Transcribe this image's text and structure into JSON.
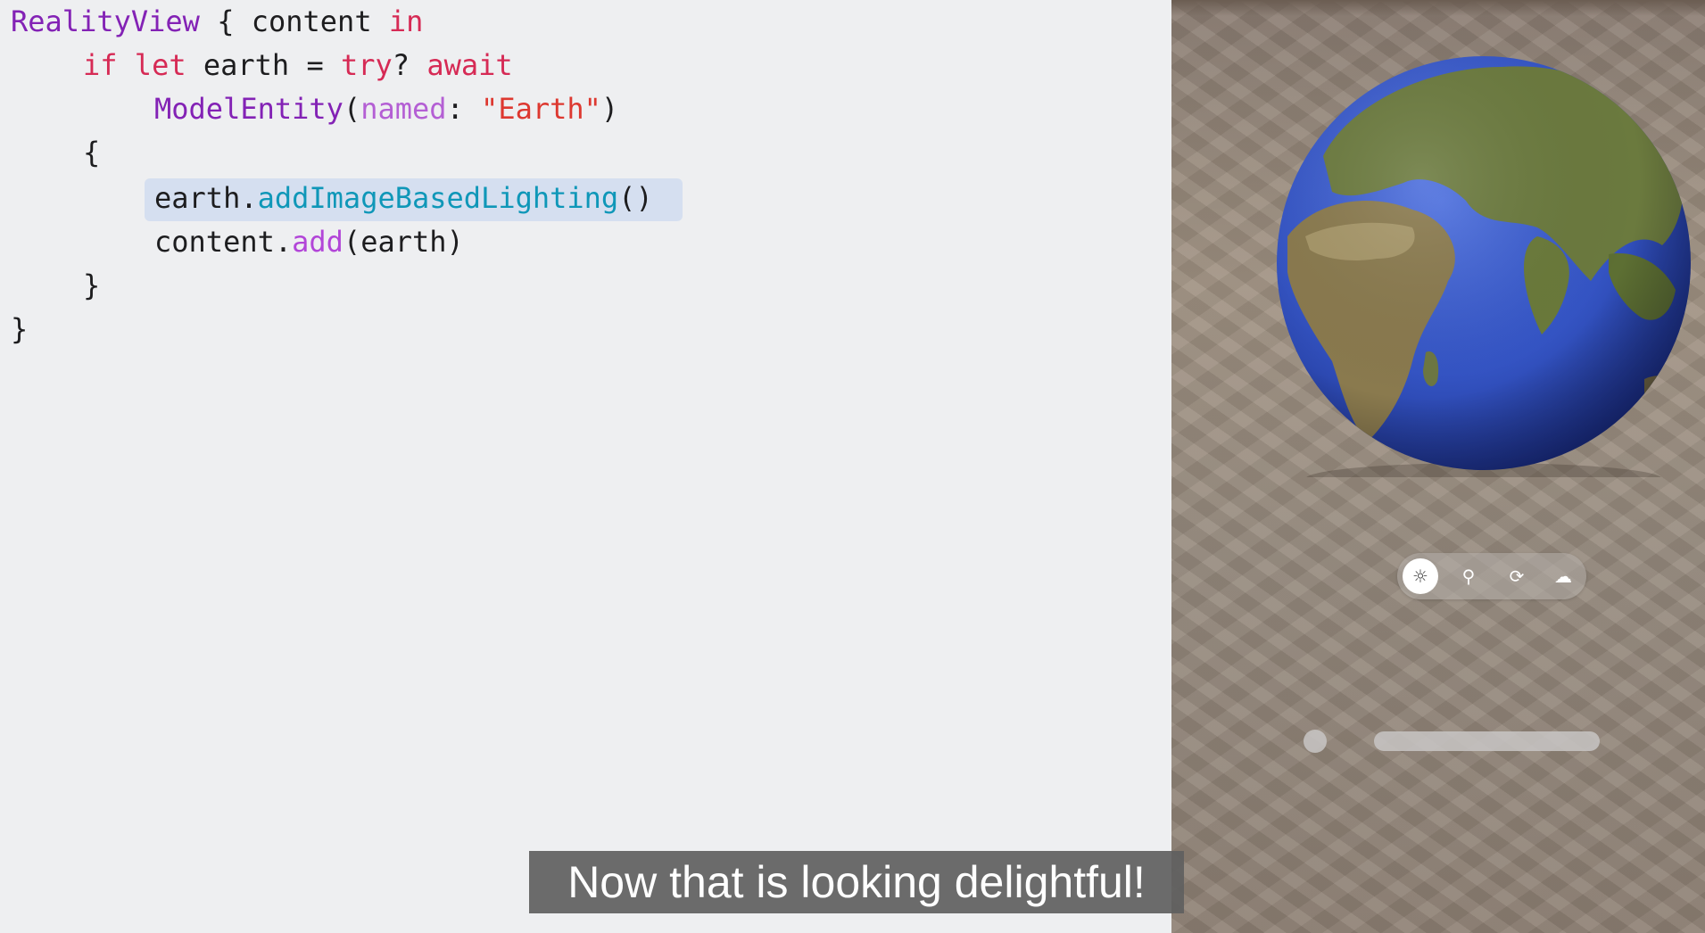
{
  "code": {
    "line1": {
      "type": "RealityView",
      "brace": " { ",
      "content": "content",
      "sp": " ",
      "kw_in": "in"
    },
    "line2": {
      "kw_if": "if",
      "sp1": " ",
      "kw_let": "let",
      "var": " earth = ",
      "kw_try": "try",
      "q": "? ",
      "kw_await": "await"
    },
    "line3": {
      "type": "ModelEntity",
      "open": "(",
      "param": "named",
      "colon": ": ",
      "str": "\"Earth\"",
      "close": ")"
    },
    "line4": {
      "brace": "{"
    },
    "line5": {
      "obj": "earth.",
      "fn": "addImageBasedLighting",
      "parens": "()"
    },
    "line6": {
      "obj": "content.",
      "fn": "add",
      "args": "(earth)"
    },
    "line7": {
      "brace": "}"
    },
    "line8": {
      "brace": "}"
    }
  },
  "caption": {
    "text": "Now that is looking delightful!"
  },
  "preview": {
    "toolbar": [
      {
        "icon": "sun-icon",
        "glyph": "☼",
        "active": true
      },
      {
        "icon": "joystick-icon",
        "glyph": "⚲",
        "active": false
      },
      {
        "icon": "rotate-icon",
        "glyph": "⟳",
        "active": false
      },
      {
        "icon": "cloud-sun-icon",
        "glyph": "☁",
        "active": false
      }
    ]
  },
  "colors": {
    "keyword": "#d62a55",
    "type": "#8322b5",
    "string": "#dd3830",
    "function_teal": "#0f97b8",
    "function_purple": "#b245d8",
    "highlight": "#d5dff0",
    "ocean": "#3454c4"
  }
}
